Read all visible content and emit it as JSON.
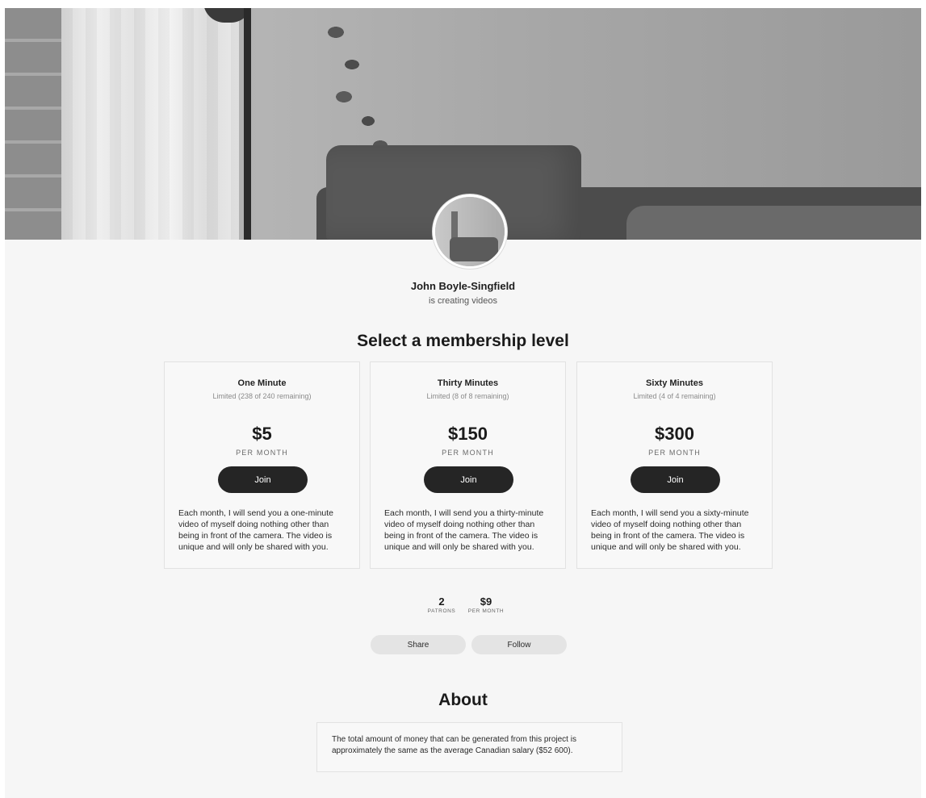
{
  "creator": {
    "name": "John Boyle-Singfield",
    "tagline": "is creating videos"
  },
  "membership": {
    "title": "Select a membership level",
    "tiers": [
      {
        "name": "One Minute",
        "limit": "Limited (238 of 240 remaining)",
        "price": "$5",
        "period": "PER MONTH",
        "cta": "Join",
        "description": "Each month, I will send you a one-minute video of myself doing nothing other than being in front of the camera. The video is unique and will only be shared with you."
      },
      {
        "name": "Thirty Minutes",
        "limit": "Limited (8 of 8 remaining)",
        "price": "$150",
        "period": "PER MONTH",
        "cta": "Join",
        "description": "Each month, I will send you a thirty-minute video of myself doing nothing other than being in front of the camera. The video is unique and will only be shared with you."
      },
      {
        "name": "Sixty Minutes",
        "limit": "Limited (4 of 4 remaining)",
        "price": "$300",
        "period": "PER MONTH",
        "cta": "Join",
        "description": "Each month, I will send you a sixty-minute video of myself doing nothing other than being in front of the camera. The video is unique and will only be shared with you."
      }
    ]
  },
  "stats": {
    "patrons_value": "2",
    "patrons_label": "PATRONS",
    "income_value": "$9",
    "income_label": "PER MONTH"
  },
  "actions": {
    "share": "Share",
    "follow": "Follow"
  },
  "about": {
    "title": "About",
    "text": "The total amount of money that can be generated from this project is approximately the same as the average Canadian salary ($52 600)."
  },
  "colors": {
    "background": "#f6f6f6",
    "join_button": "#252525",
    "pill_button": "#e4e4e4"
  }
}
